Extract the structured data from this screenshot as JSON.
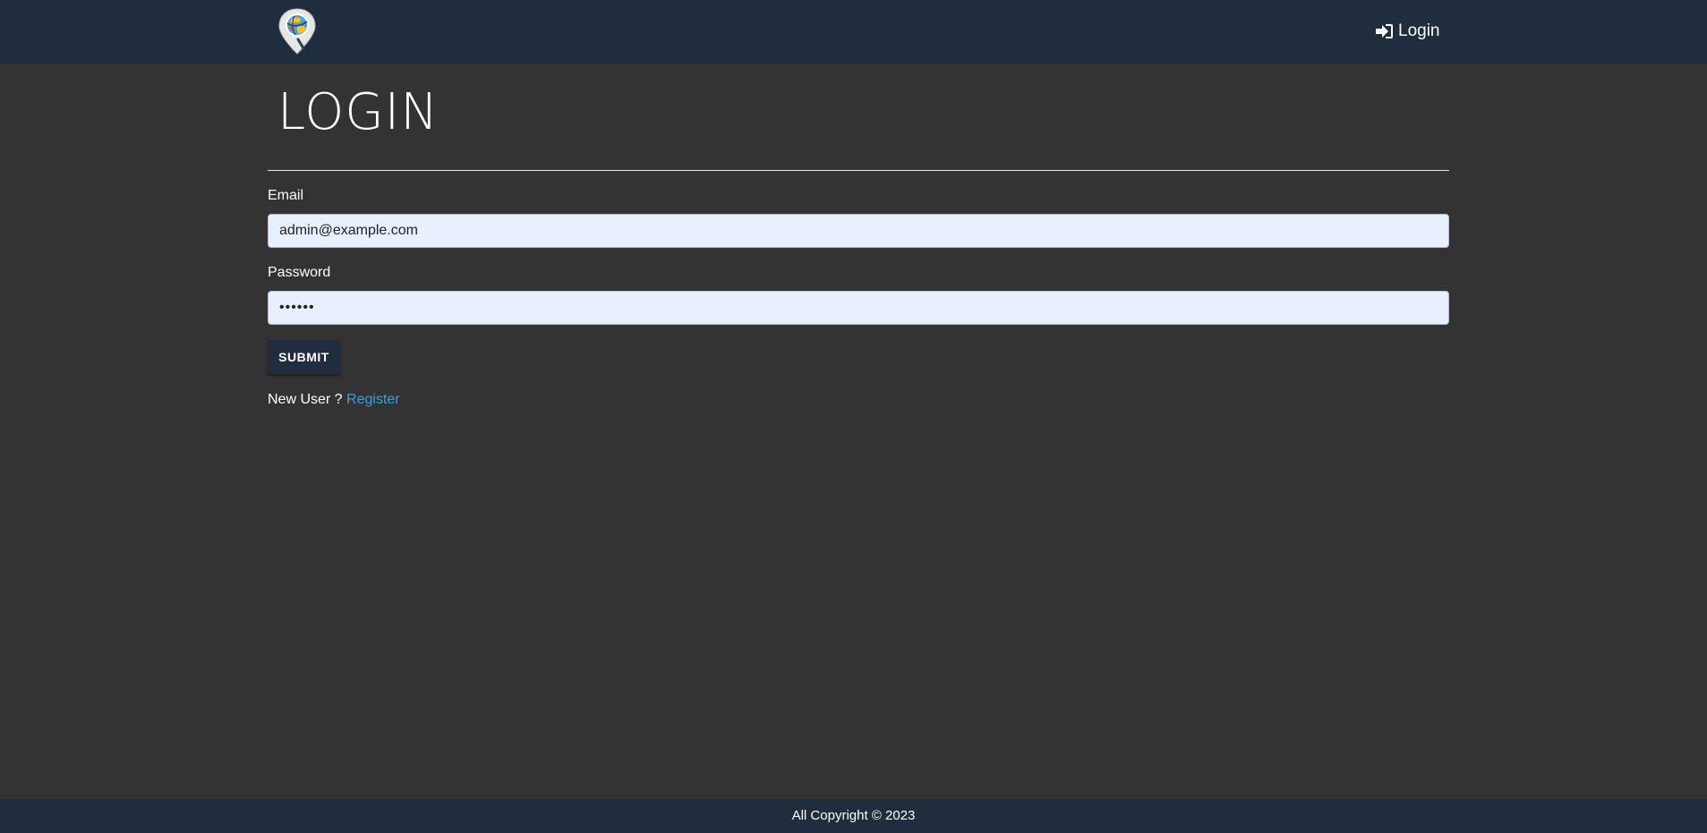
{
  "navbar": {
    "logo_icon": "map-pin-globe-icon",
    "login_icon": "sign-in-icon",
    "login_label": "Login"
  },
  "main": {
    "title": "LOGIN",
    "email_label": "Email",
    "email_value": "admin@example.com",
    "password_label": "Password",
    "password_value": "••••••",
    "submit_label": "SUBMIT",
    "new_user_text": "New User ?",
    "register_label": "Register"
  },
  "footer": {
    "text": "All Copyright © 2023"
  },
  "colors": {
    "navbar_bg": "#1f2d3f",
    "page_bg": "#333333",
    "input_bg": "#e8f0fe",
    "link": "#3a9fd8"
  }
}
